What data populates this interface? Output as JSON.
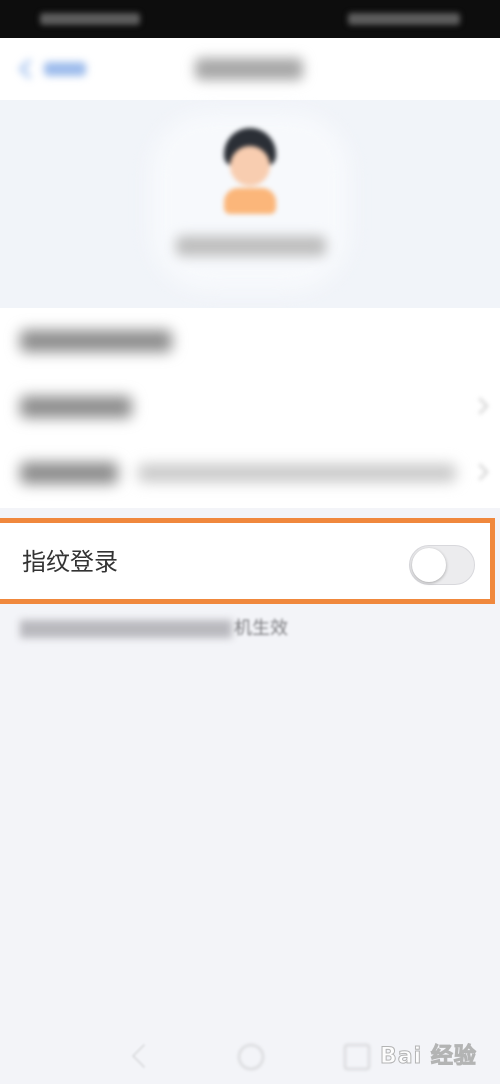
{
  "fingerprint_row": {
    "label": "指纹登录",
    "enabled": false
  },
  "note": {
    "visible_tail": "机生效"
  },
  "colors": {
    "highlight_border": "#f0883d",
    "toggle_off": "#ececee",
    "page_background": "#f3f4f8"
  },
  "watermark": {
    "text": "Bai 经验"
  }
}
